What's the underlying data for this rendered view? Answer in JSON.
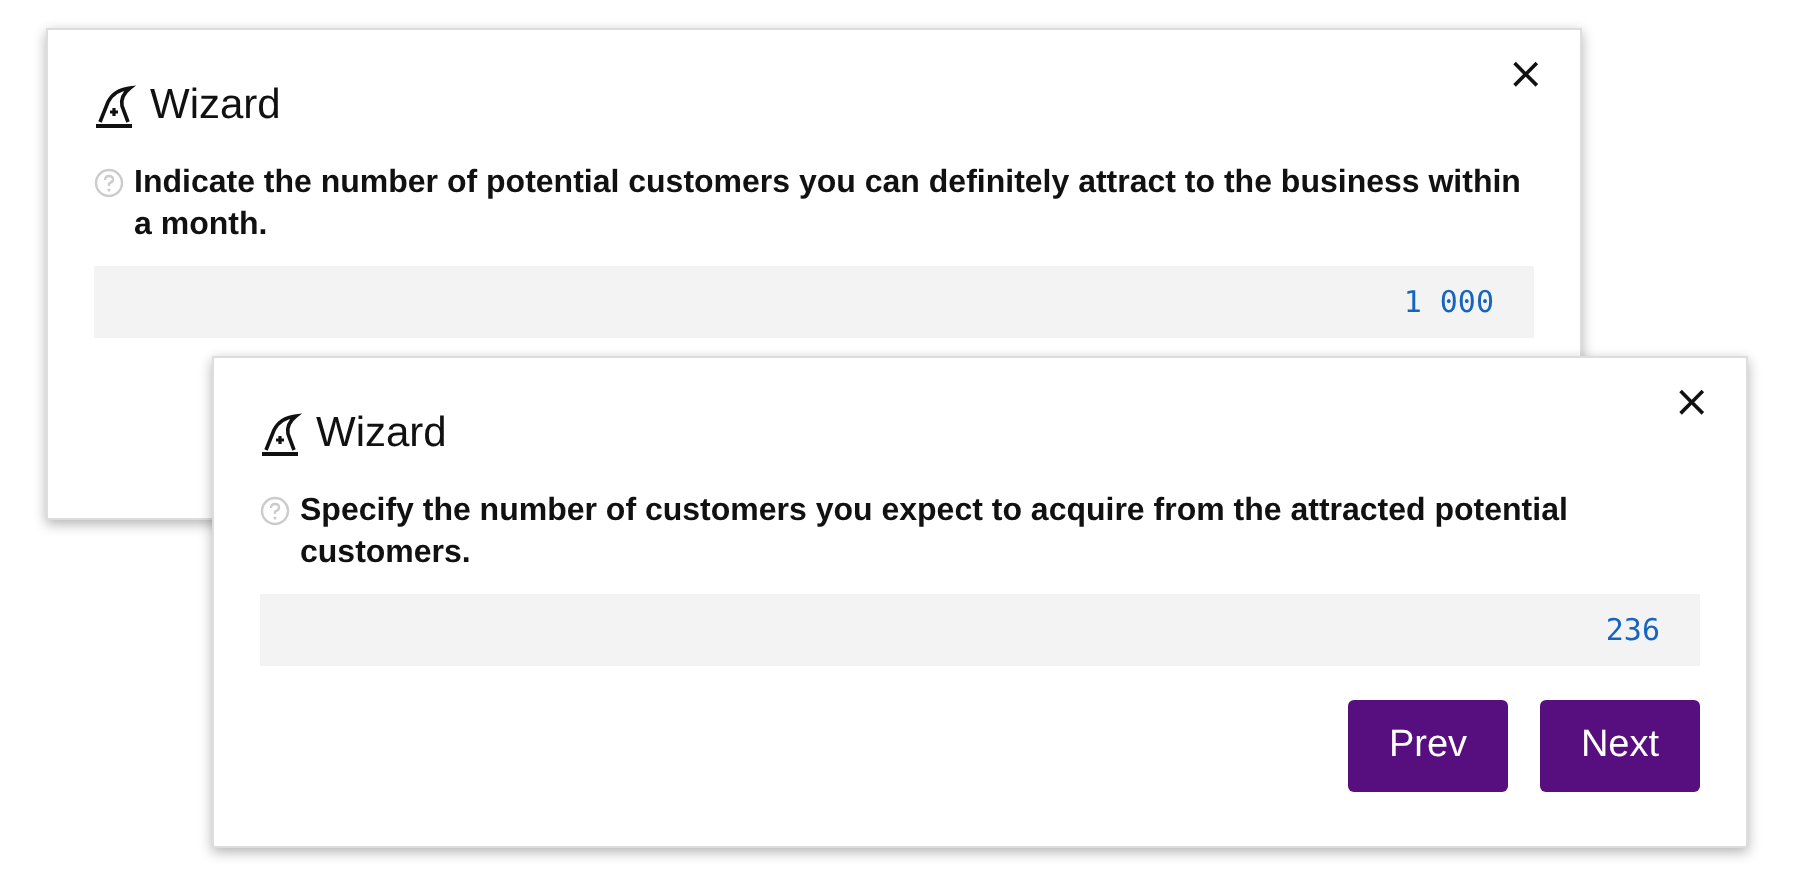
{
  "dialogs": [
    {
      "title": "Wizard",
      "close": "×",
      "question": "Indicate the number of potential customers you can definitely attract to the business within a month.",
      "value": "1 000"
    },
    {
      "title": "Wizard",
      "close": "×",
      "question": "Specify the number of customers you expect to acquire from the attracted potential customers.",
      "value": "236",
      "buttons": [
        "Prev",
        "Next"
      ]
    }
  ]
}
